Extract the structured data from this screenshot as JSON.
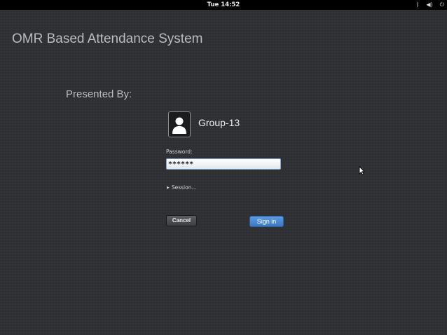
{
  "topbar": {
    "clock": "Tue 14:52",
    "tray_icons": [
      "bluetooth-icon",
      "volume-icon",
      "power-icon"
    ]
  },
  "slide": {
    "title": "OMR Based Attendance System",
    "presented_by": "Presented By:"
  },
  "login": {
    "username": "Group-13",
    "password_label": "Password:",
    "password_value": "******",
    "session_label": "Session...",
    "cancel_label": "Cancel",
    "signin_label": "Sign in"
  },
  "colors": {
    "background": "#2e3033",
    "accent": "#4a88d3"
  }
}
